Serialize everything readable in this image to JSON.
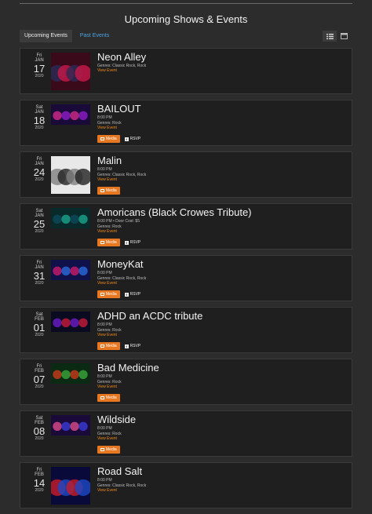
{
  "header": {
    "title": "Upcoming Shows & Events"
  },
  "tabs": [
    {
      "label": "Upcoming Events"
    },
    {
      "label": "Past Events"
    }
  ],
  "view_toggle": {
    "list_icon": "list-icon",
    "calendar_icon": "calendar-icon"
  },
  "labels": {
    "view_event": "View Event",
    "media": "Media",
    "rsvp": "RSVP"
  },
  "events": [
    {
      "dow": "Fri",
      "month": "JAN",
      "day": "17",
      "year": "2020",
      "name": "Neon Alley",
      "time": "",
      "genres": "Genres: Classic Rock, Rock",
      "media": false,
      "rsvp": false
    },
    {
      "dow": "Sat",
      "month": "JAN",
      "day": "18",
      "year": "2020",
      "name": "BAILOUT",
      "time": "8:00 PM",
      "genres": "Genres: Rock",
      "media": true,
      "rsvp": true
    },
    {
      "dow": "Fri",
      "month": "JAN",
      "day": "24",
      "year": "2020",
      "name": "Malin",
      "time": "8:00 PM",
      "genres": "Genres: Classic Rock, Rock",
      "media": true,
      "rsvp": false
    },
    {
      "dow": "Sat",
      "month": "JAN",
      "day": "25",
      "year": "2020",
      "name": "Amoricans (Black Crowes Tribute)",
      "time": "8:00 PM • Door Cost: $5",
      "genres": "Genres: Rock",
      "media": true,
      "rsvp": true
    },
    {
      "dow": "Fri",
      "month": "JAN",
      "day": "31",
      "year": "2020",
      "name": "MoneyKat",
      "time": "8:00 PM",
      "genres": "Genres: Classic Rock, Rock",
      "media": true,
      "rsvp": true
    },
    {
      "dow": "Sat",
      "month": "FEB",
      "day": "01",
      "year": "2020",
      "name": "ADHD an ACDC tribute",
      "time": "8:00 PM",
      "genres": "Genres: Rock",
      "media": true,
      "rsvp": true
    },
    {
      "dow": "Fri",
      "month": "FEB",
      "day": "07",
      "year": "2020",
      "name": "Bad Medicine",
      "time": "8:00 PM",
      "genres": "Genres: Rock",
      "media": true,
      "rsvp": false
    },
    {
      "dow": "Sat",
      "month": "FEB",
      "day": "08",
      "year": "2020",
      "name": "Wildside",
      "time": "8:00 PM",
      "genres": "Genres: Rock",
      "media": true,
      "rsvp": false
    },
    {
      "dow": "Fri",
      "month": "FEB",
      "day": "14",
      "year": "2020",
      "name": "Road Salt",
      "time": "8:00 PM",
      "genres": "Genres: Classic Rock, Rock",
      "media": false,
      "rsvp": false
    }
  ]
}
